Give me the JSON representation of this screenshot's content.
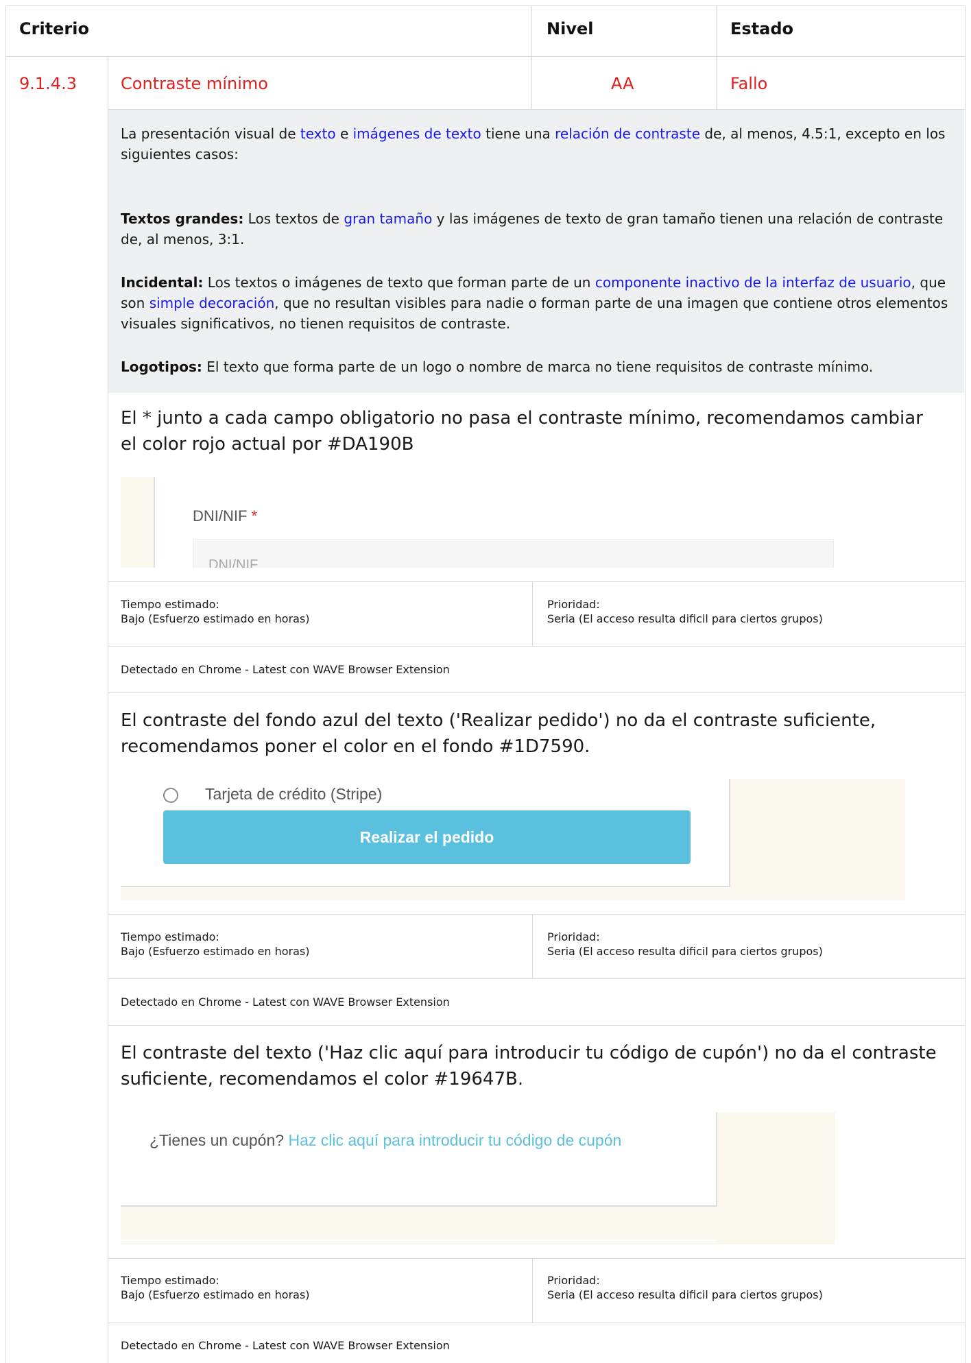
{
  "header": {
    "criterio": "Criterio",
    "nivel": "Nivel",
    "estado": "Estado"
  },
  "criterion": {
    "id": "9.1.4.3",
    "name": "Contraste mínimo",
    "level": "AA",
    "status": "Fallo",
    "status_color": "#e02020"
  },
  "description": {
    "p1_a": "La presentación visual de ",
    "p1_link1": "texto",
    "p1_b": " e ",
    "p1_link2": "imágenes de texto",
    "p1_c": " tiene una ",
    "p1_link3": "relación de contraste",
    "p1_d": " de, al menos, 4.5:1, excepto en los siguientes casos:",
    "p2_bold": "Textos grandes:",
    "p2_a": " Los textos de ",
    "p2_link": "gran tamaño",
    "p2_b": " y las imágenes de texto de gran tamaño tienen una relación de contraste de, al menos, 3:1.",
    "p3_bold": "Incidental:",
    "p3_a": " Los textos o imágenes de texto que forman parte de un ",
    "p3_link1": "componente inactivo de la interfaz de usuario",
    "p3_b": ", que son ",
    "p3_link2": "simple decoración",
    "p3_c": ", que no resultan visibles para nadie o forman parte de una imagen que contiene otros elementos visuales significativos, no tienen requisitos de contraste.",
    "p4_bold": "Logotipos:",
    "p4_a": " El texto que forma parte de un logo o nombre de marca no tiene requisitos de contraste mínimo."
  },
  "issues": [
    {
      "title": "El * junto a cada campo obligatorio no pasa el contraste mínimo, recomendamos cambiar el color rojo actual por #DA190B",
      "tiempo_label": "Tiempo estimado:",
      "tiempo_value": "Bajo (Esfuerzo estimado en horas)",
      "prioridad_label": "Prioridad:",
      "prioridad_value": "Seria (El acceso resulta dificil para ciertos grupos)",
      "detected": "Detectado en Chrome - Latest con WAVE Browser Extension",
      "shot_label": "DNI/NIF",
      "shot_star": "*",
      "shot_placeholder": "DNI/NIF"
    },
    {
      "title": "El contraste del fondo azul del texto ('Realizar pedido') no da el contraste suficiente, recomendamos poner el color en el fondo #1D7590.",
      "tiempo_label": "Tiempo estimado:",
      "tiempo_value": "Bajo (Esfuerzo estimado en horas)",
      "prioridad_label": "Prioridad:",
      "prioridad_value": "Seria (El acceso resulta dificil para ciertos grupos)",
      "detected": "Detectado en Chrome - Latest con WAVE Browser Extension",
      "shot_radio": "Tarjeta de crédito (Stripe)",
      "shot_button": "Realizar el pedido"
    },
    {
      "title": "El contraste del texto ('Haz clic aquí para introducir tu código de cupón') no da el contraste suficiente, recomendamos el color #19647B.",
      "tiempo_label": "Tiempo estimado:",
      "tiempo_value": "Bajo (Esfuerzo estimado en horas)",
      "prioridad_label": "Prioridad:",
      "prioridad_value": "Seria (El acceso resulta dificil para ciertos grupos)",
      "detected": "Detectado en Chrome - Latest con WAVE Browser Extension",
      "shot_question": "¿Tienes un cupón?",
      "shot_link": "Haz clic aquí para introducir tu código de cupón"
    }
  ]
}
